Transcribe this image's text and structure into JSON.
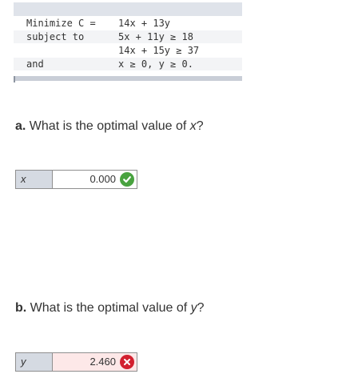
{
  "problem": {
    "rows": [
      {
        "left": "Minimize C =",
        "right": "14x + 13y"
      },
      {
        "left": "subject to",
        "right": "5x + 11y ≥ 18"
      },
      {
        "left": "",
        "right": "14x + 15y ≥ 37"
      },
      {
        "left": "and",
        "right": "x ≥ 0, y ≥ 0."
      }
    ]
  },
  "questions": [
    {
      "letter": "a.",
      "text": "What is the optimal value of",
      "var": "x",
      "suffix": "?",
      "answer_label": "x",
      "answer_value": "0.000",
      "status": "correct",
      "status_icon": "check-icon"
    },
    {
      "letter": "b.",
      "text": "What is the optimal value of",
      "var": "y",
      "suffix": "?",
      "answer_label": "y",
      "answer_value": "2.460",
      "status": "incorrect",
      "status_icon": "x-icon"
    }
  ],
  "colors": {
    "correct": "#48a23f",
    "incorrect": "#d2202f",
    "incorrect_bg": "#fde8e8",
    "label_bg": "#d5dae2"
  }
}
